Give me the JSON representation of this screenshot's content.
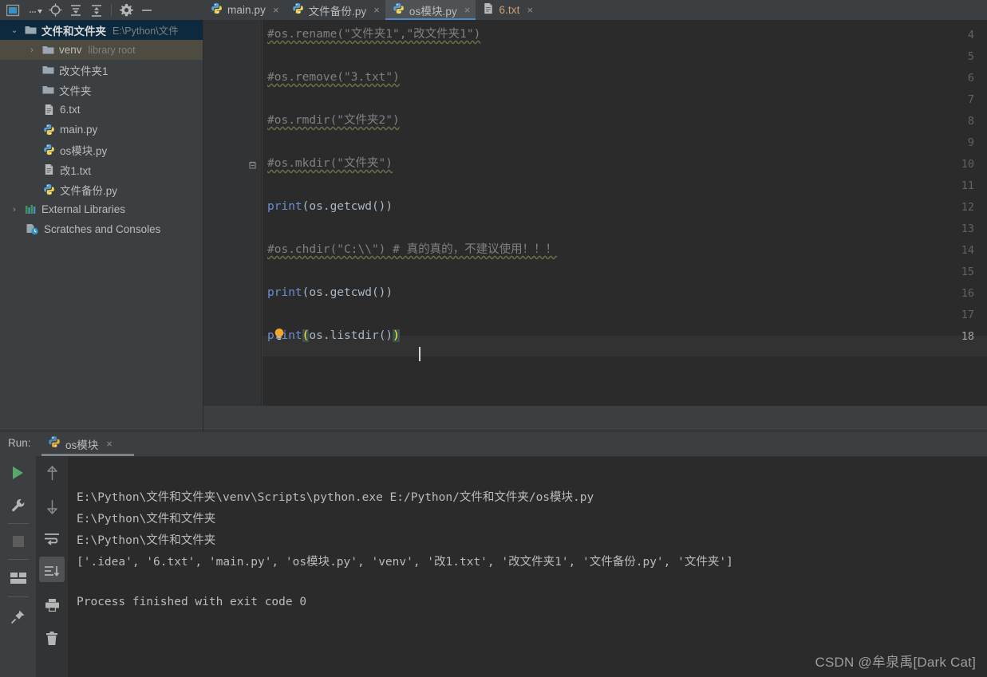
{
  "window": {
    "toolbar_icons": [
      "window-selector-icon",
      "dropdown-arrow-icon",
      "locate-icon",
      "collapse-all-icon",
      "expand-all-icon",
      "settings-gear-icon",
      "hide-icon"
    ]
  },
  "editor_tabs": [
    {
      "label": "main.py",
      "icon": "python-file-icon",
      "active": false,
      "modified": false,
      "close": "×"
    },
    {
      "label": "文件备份.py",
      "icon": "python-file-icon",
      "active": false,
      "modified": false,
      "close": "×"
    },
    {
      "label": "os模块.py",
      "icon": "python-file-icon",
      "active": true,
      "modified": false,
      "close": "×"
    },
    {
      "label": "6.txt",
      "icon": "text-file-icon",
      "active": false,
      "modified": true,
      "close": "×"
    }
  ],
  "project_tree": [
    {
      "label": "文件和文件夹",
      "sub": "E:\\Python\\文件",
      "indent": 0,
      "arrow": "⌄",
      "icon": "folder-icon",
      "bold": true,
      "selection": "blue"
    },
    {
      "label": "venv",
      "sub": "library root",
      "indent": 1,
      "arrow": "›",
      "icon": "folder-icon",
      "bold": false,
      "selection": "grey"
    },
    {
      "label": "改文件夹1",
      "sub": "",
      "indent": 2,
      "arrow": "",
      "icon": "folder-icon",
      "bold": false,
      "selection": "none"
    },
    {
      "label": "文件夹",
      "sub": "",
      "indent": 2,
      "arrow": "",
      "icon": "folder-icon",
      "bold": false,
      "selection": "none"
    },
    {
      "label": "6.txt",
      "sub": "",
      "indent": 2,
      "arrow": "",
      "icon": "text-file-icon",
      "bold": false,
      "selection": "none"
    },
    {
      "label": "main.py",
      "sub": "",
      "indent": 2,
      "arrow": "",
      "icon": "python-file-icon",
      "bold": false,
      "selection": "none"
    },
    {
      "label": "os模块.py",
      "sub": "",
      "indent": 2,
      "arrow": "",
      "icon": "python-file-icon",
      "bold": false,
      "selection": "none"
    },
    {
      "label": "改1.txt",
      "sub": "",
      "indent": 2,
      "arrow": "",
      "icon": "text-file-icon",
      "bold": false,
      "selection": "none"
    },
    {
      "label": "文件备份.py",
      "sub": "",
      "indent": 2,
      "arrow": "",
      "icon": "python-file-icon",
      "bold": false,
      "selection": "none"
    },
    {
      "label": "External Libraries",
      "sub": "",
      "indent": 0,
      "arrow": "›",
      "icon": "libraries-icon",
      "bold": false,
      "selection": "none"
    },
    {
      "label": "Scratches and Consoles",
      "sub": "",
      "indent": 1,
      "arrow": "",
      "icon": "scratches-icon",
      "bold": false,
      "selection": "none"
    }
  ],
  "code": {
    "first_line_number": 4,
    "lines": [
      {
        "n": 4,
        "segments": [
          {
            "t": "#os.rename(\"文件夹1\",\"改文件夹1\")",
            "c": "cmt"
          }
        ],
        "fold": false
      },
      {
        "n": 5,
        "segments": [],
        "fold": false
      },
      {
        "n": 6,
        "segments": [
          {
            "t": "#os.remove(\"3.txt\")",
            "c": "cmt"
          }
        ],
        "fold": false
      },
      {
        "n": 7,
        "segments": [],
        "fold": false
      },
      {
        "n": 8,
        "segments": [
          {
            "t": "#os.rmdir(\"文件夹2\")",
            "c": "cmt"
          }
        ],
        "fold": false
      },
      {
        "n": 9,
        "segments": [],
        "fold": false
      },
      {
        "n": 10,
        "segments": [
          {
            "t": "#os.mkdir(\"文件夹\")",
            "c": "cmt"
          }
        ],
        "fold": true
      },
      {
        "n": 11,
        "segments": [],
        "fold": false
      },
      {
        "n": 12,
        "segments": [
          {
            "t": "print",
            "c": "kw"
          },
          {
            "t": "(os.getcwd())",
            "c": "plain"
          }
        ],
        "fold": false
      },
      {
        "n": 13,
        "segments": [],
        "fold": false
      },
      {
        "n": 14,
        "segments": [
          {
            "t": "#os.chdir(\"C:\\\\\") # 真的真的，不建议使用！！！",
            "c": "cmt"
          }
        ],
        "fold": false
      },
      {
        "n": 15,
        "segments": [],
        "fold": false
      },
      {
        "n": 16,
        "segments": [
          {
            "t": "print",
            "c": "kw"
          },
          {
            "t": "(os.getcwd())",
            "c": "plain"
          }
        ],
        "fold": false
      },
      {
        "n": 17,
        "segments": [],
        "fold": false,
        "bulb": true
      },
      {
        "n": 18,
        "segments": [
          {
            "t": "print",
            "c": "kw"
          },
          {
            "t": "(",
            "c": "brace-hl"
          },
          {
            "t": "os.listdir()",
            "c": "plain"
          },
          {
            "t": ")",
            "c": "brace-hl"
          }
        ],
        "fold": false,
        "caret": true
      }
    ]
  },
  "run_panel": {
    "label": "Run:",
    "tab_label": "os模块",
    "tab_close": "×",
    "tab_icon": "python-file-icon",
    "left_icons": [
      "run-button",
      "wrench-icon",
      "stop-icon",
      "layout-icon",
      "pin-icon"
    ],
    "right_icons": [
      "arrow-up-icon",
      "arrow-down-icon",
      "soft-wrap-icon",
      "scroll-to-end-icon",
      "print-icon",
      "trash-icon"
    ],
    "console_lines": [
      "E:\\Python\\文件和文件夹\\venv\\Scripts\\python.exe E:/Python/文件和文件夹/os模块.py",
      "E:\\Python\\文件和文件夹",
      "E:\\Python\\文件和文件夹",
      "['.idea', '6.txt', 'main.py', 'os模块.py', 'venv', '改1.txt', '改文件夹1', '文件备份.py', '文件夹']",
      "",
      "Process finished with exit code 0"
    ]
  },
  "watermark": "CSDN @牟泉禹[Dark Cat]",
  "colors": {
    "panel_bg": "#3c3f41",
    "editor_bg": "#2b2b2b",
    "gutter_bg": "#313335",
    "tab_active_bg": "#4e5254",
    "tab_underline": "#4a88c7",
    "tree_selection_blue": "#0d293e",
    "tree_selection_grey": "#4e4b41",
    "text": "#bbbbbb",
    "keyword": "#6a8fd4",
    "comment": "#808080",
    "code_plain": "#a9b7c6",
    "modified_tab": "#c9a26d",
    "run_green": "#59a869"
  }
}
